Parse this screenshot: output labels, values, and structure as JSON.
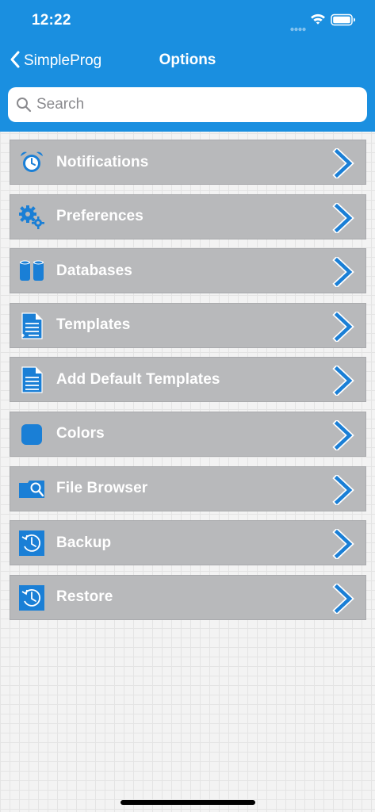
{
  "status_bar": {
    "time": "12:22",
    "icons": [
      "signal-icon",
      "wifi-icon",
      "battery-icon"
    ]
  },
  "nav": {
    "back_label": "SimpleProg",
    "title": "Options"
  },
  "search": {
    "placeholder": "Search",
    "value": ""
  },
  "menu": {
    "items": [
      {
        "label": "Notifications",
        "icon": "alarm-clock-icon"
      },
      {
        "label": "Preferences",
        "icon": "gears-icon"
      },
      {
        "label": "Databases",
        "icon": "database-icon"
      },
      {
        "label": "Templates",
        "icon": "document-icon"
      },
      {
        "label": "Add Default Templates",
        "icon": "document-icon"
      },
      {
        "label": "Colors",
        "icon": "color-swatch-icon"
      },
      {
        "label": "File Browser",
        "icon": "folder-search-icon"
      },
      {
        "label": "Backup",
        "icon": "history-clock-icon"
      },
      {
        "label": "Restore",
        "icon": "history-clock-icon"
      }
    ]
  },
  "colors": {
    "header": "#1a8fe0",
    "row_background": "#b8b9bb",
    "accent": "#1a7fd6",
    "text_on_row": "#ffffff"
  }
}
